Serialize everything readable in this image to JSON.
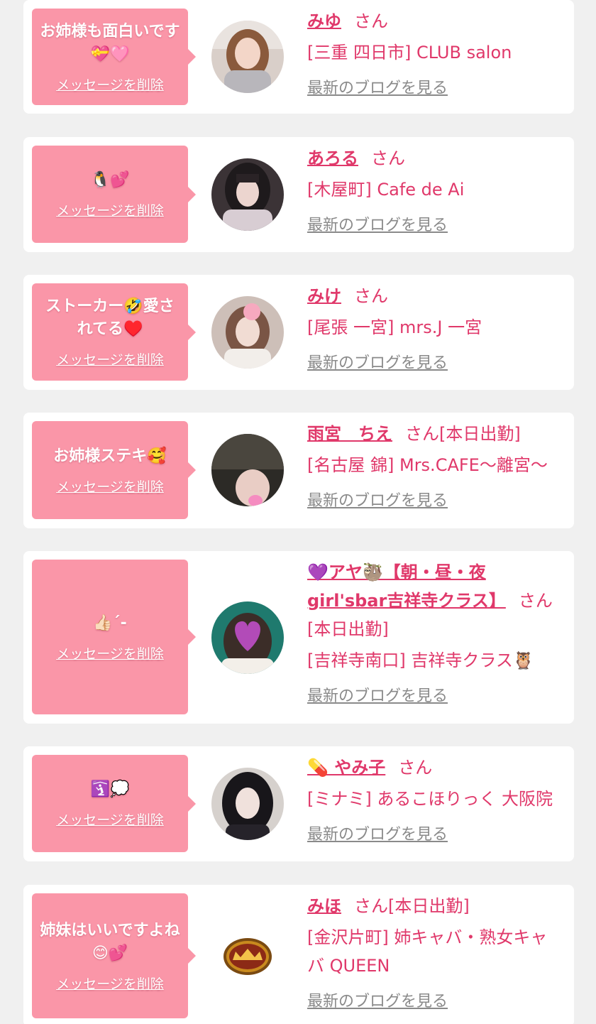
{
  "delete_label": "メッセージを削除",
  "blog_label": "最新のブログを見る",
  "honorific": "さん",
  "messages": [
    {
      "message": "お姉様も面白いです💝🩷",
      "name": "みゆ",
      "status": "",
      "shop": "[三重 四日市] CLUB salon",
      "avatar_icon": "portrait-photo"
    },
    {
      "message": "🐧💕",
      "name": "あろる",
      "status": "",
      "shop": "[木屋町] Cafe de Ai",
      "avatar_icon": "portrait-photo"
    },
    {
      "message": "ストーカー🤣愛されてる♥️",
      "name": "みけ",
      "status": "",
      "shop": "[尾張 一宮] mrs.J 一宮",
      "avatar_icon": "portrait-photo"
    },
    {
      "message": "お姉様ステキ🥰",
      "name": "雨宮　ちえ",
      "status": "[本日出勤]",
      "shop": "[名古屋 錦] Mrs.CAFE〜離宮〜",
      "avatar_icon": "portrait-photo"
    },
    {
      "message": "👍🏻´-",
      "name": "💜アヤ🦥【朝・昼・夜girl'sbar吉祥寺クラス】",
      "status": "[本日出勤]",
      "shop": "[吉祥寺南口] 吉祥寺クラス🦉",
      "avatar_icon": "portrait-photo"
    },
    {
      "message": "🛐💭",
      "name": "💊 やみ子",
      "status": "",
      "shop": "[ミナミ] あるこほりっく 大阪院",
      "avatar_icon": "portrait-photo"
    },
    {
      "message": "姉妹はいいですよね😊💕",
      "name": "みほ",
      "status": "[本日出勤]",
      "shop": "[金沢片町] 姉キャバ・熟女キャバ QUEEN",
      "avatar_icon": "queen-logo"
    }
  ]
}
